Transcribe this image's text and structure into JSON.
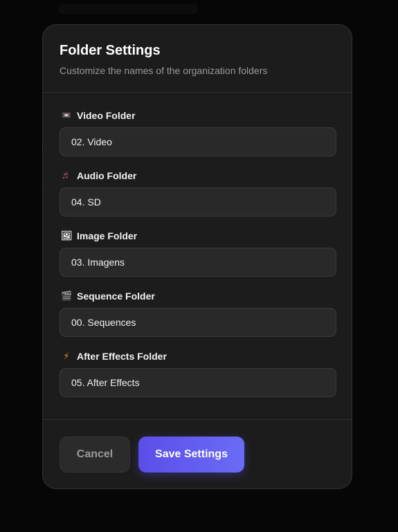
{
  "modal": {
    "title": "Folder Settings",
    "subtitle": "Customize the names of the organization folders"
  },
  "fields": [
    {
      "label": "Video Folder",
      "icon": "video-camera-icon",
      "glyph": "📼",
      "value": "02. Video"
    },
    {
      "label": "Audio Folder",
      "icon": "music-note-icon",
      "glyph": "♬",
      "value": "04. SD"
    },
    {
      "label": "Image Folder",
      "icon": "picture-icon",
      "glyph": "🖼",
      "value": "03. Imagens"
    },
    {
      "label": "Sequence Folder",
      "icon": "clapperboard-icon",
      "glyph": "🎬",
      "value": "00. Sequences"
    },
    {
      "label": "After Effects Folder",
      "icon": "lightning-icon",
      "glyph": "⚡",
      "value": "05. After Effects"
    }
  ],
  "footer": {
    "cancel_label": "Cancel",
    "save_label": "Save Settings"
  },
  "colors": {
    "accent": "#5b4ee8",
    "lightning": "#f0822a",
    "music": "#b0506a"
  }
}
